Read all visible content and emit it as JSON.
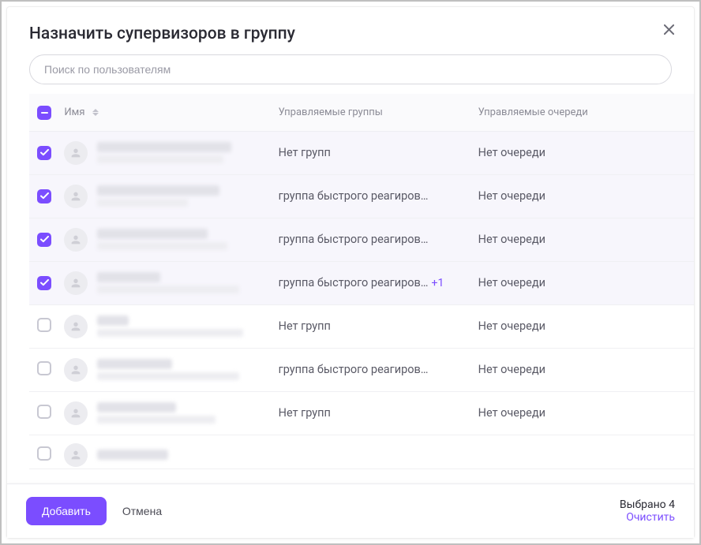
{
  "modal": {
    "title": "Назначить супервизоров в группу"
  },
  "search": {
    "placeholder": "Поиск по пользователям",
    "value": ""
  },
  "columns": {
    "name": "Имя",
    "groups": "Управляемые группы",
    "queues": "Управляемые очереди"
  },
  "strings": {
    "no_groups": "Нет групп",
    "no_queue": "Нет очереди",
    "group_fast": "группа быстрого реагиров…",
    "plus1": "+1"
  },
  "rows": [
    {
      "selected": true,
      "groups_key": "no_groups",
      "queue_key": "no_queue",
      "extra": "",
      "nw1": 170,
      "nw2": 160
    },
    {
      "selected": true,
      "groups_key": "group_fast",
      "queue_key": "no_queue",
      "extra": "",
      "nw1": 155,
      "nw2": 115
    },
    {
      "selected": true,
      "groups_key": "group_fast",
      "queue_key": "no_queue",
      "extra": "",
      "nw1": 140,
      "nw2": 165
    },
    {
      "selected": true,
      "groups_key": "group_fast",
      "queue_key": "no_queue",
      "extra": "plus1",
      "nw1": 80,
      "nw2": 180
    },
    {
      "selected": false,
      "groups_key": "no_groups",
      "queue_key": "no_queue",
      "extra": "",
      "nw1": 40,
      "nw2": 185
    },
    {
      "selected": false,
      "groups_key": "group_fast",
      "queue_key": "no_queue",
      "extra": "",
      "nw1": 95,
      "nw2": 180
    },
    {
      "selected": false,
      "groups_key": "no_groups",
      "queue_key": "no_queue",
      "extra": "",
      "nw1": 100,
      "nw2": 150
    }
  ],
  "footer": {
    "add": "Добавить",
    "cancel": "Отмена",
    "selected_count": "Выбрано 4",
    "clear": "Очистить"
  }
}
